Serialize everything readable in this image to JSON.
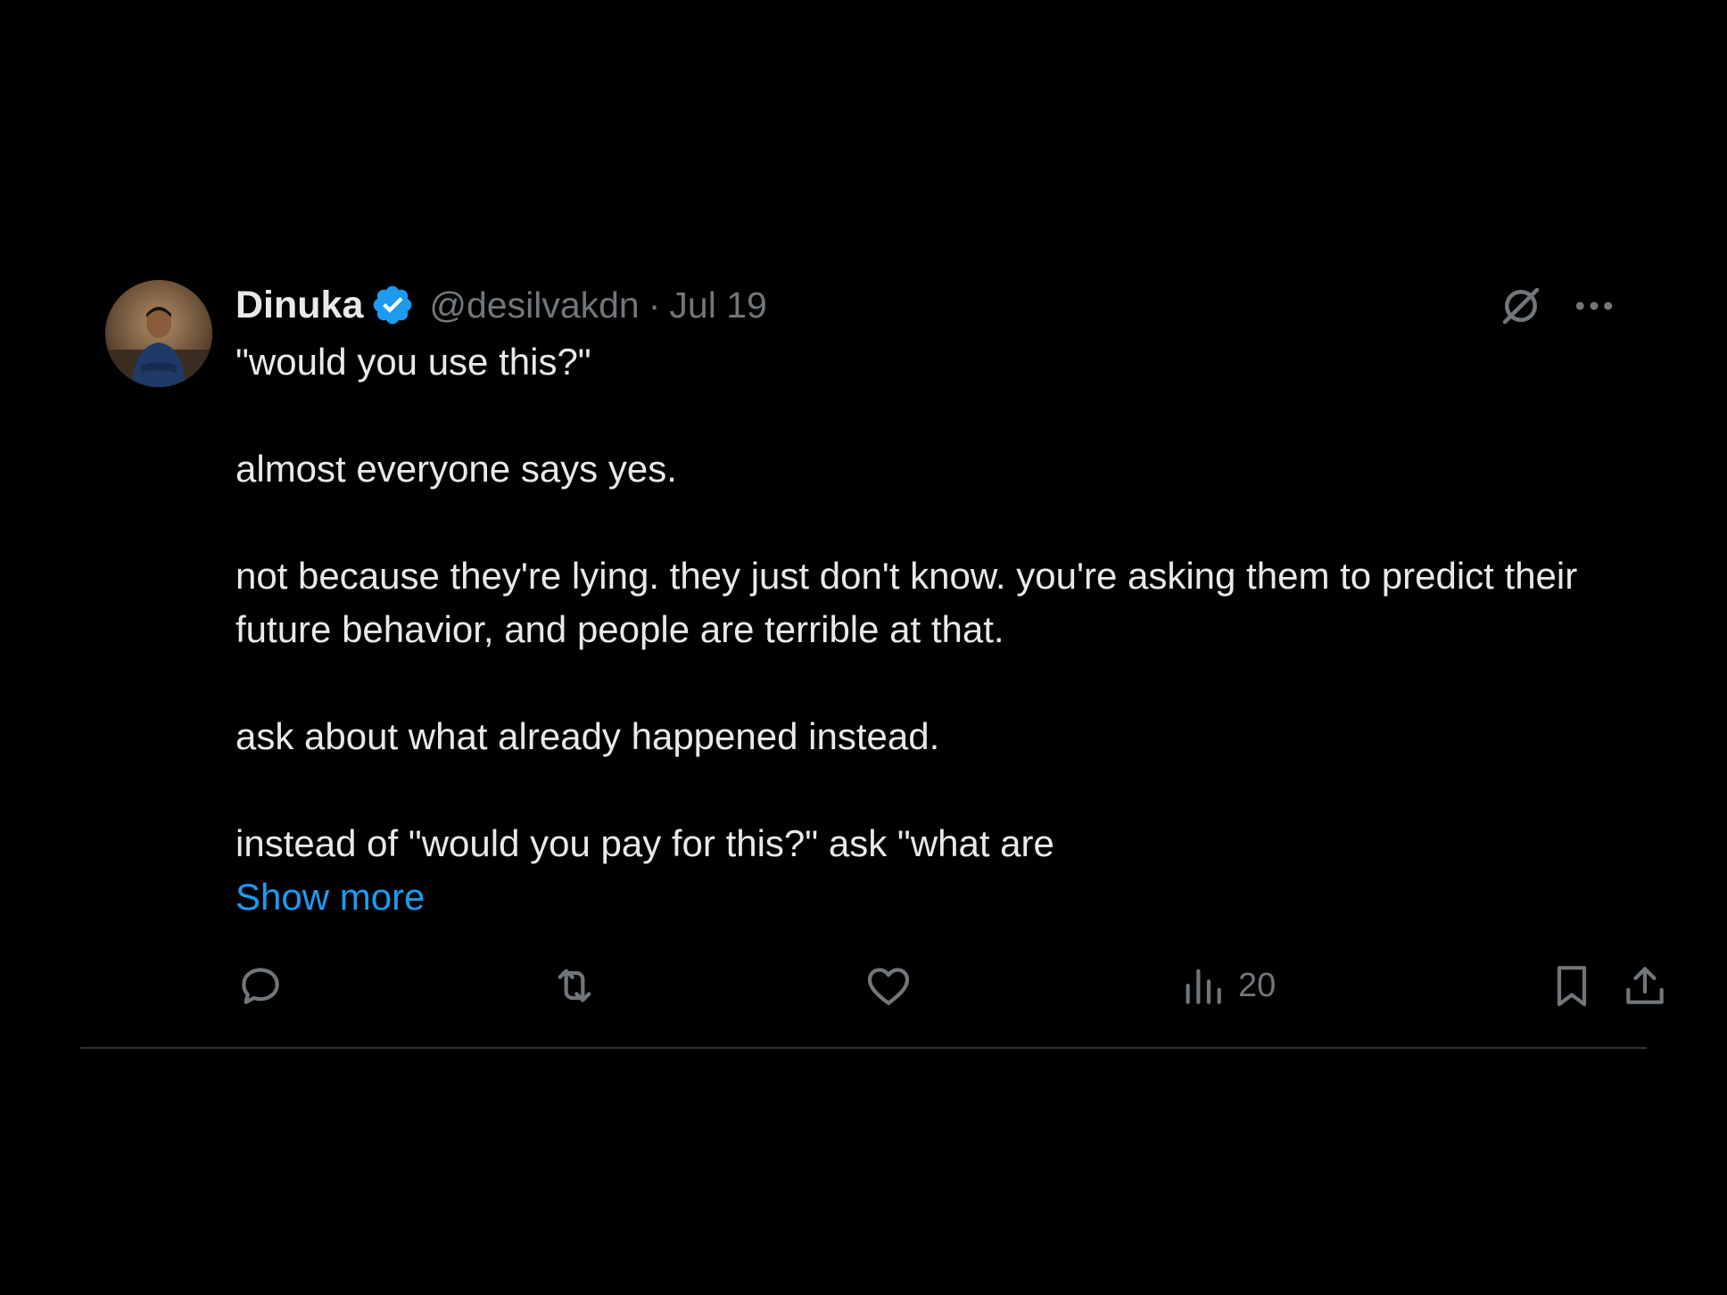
{
  "tweet": {
    "author": {
      "name": "Dinuka",
      "handle": "@desilvakdn",
      "verified": true,
      "verified_color": "#1d9bf0"
    },
    "separator": "·",
    "date": "Jul 19",
    "text": {
      "line1": "\"would you use this?\"",
      "line2": "almost everyone says yes.",
      "line3": "not because they're lying. they just don't know. you're asking them to predict their future behavior, and people are terrible at that.",
      "line4": "ask about what already happened instead.",
      "line5": "instead of \"would you pay for this?\" ask \"what are"
    },
    "show_more_label": "Show more",
    "show_more_color": "#1d9bf0",
    "actions": {
      "reply": {
        "icon": "reply-icon",
        "count": ""
      },
      "repost": {
        "icon": "repost-icon",
        "count": ""
      },
      "like": {
        "icon": "heart-icon",
        "count": ""
      },
      "views": {
        "icon": "views-icon",
        "count": "20"
      },
      "bookmark": {
        "icon": "bookmark-icon"
      },
      "share": {
        "icon": "share-icon"
      }
    },
    "header_icons": {
      "grok": "grok-icon",
      "more": "more-icon"
    }
  },
  "colors": {
    "background": "#000000",
    "text_primary": "#e7e9ea",
    "text_secondary": "#71767b",
    "divider": "#2f3336"
  }
}
